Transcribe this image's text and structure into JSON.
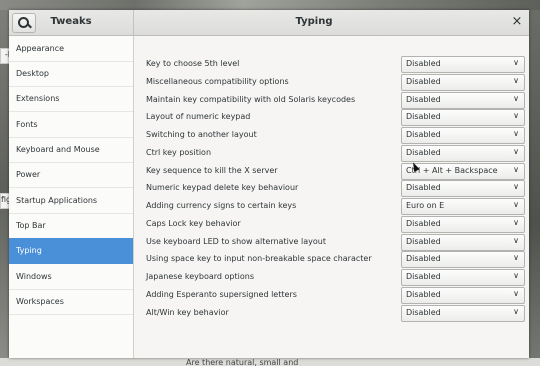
{
  "window": {
    "app_title": "Tweaks",
    "page_title": "Typing"
  },
  "header": {
    "close_glyph": "×"
  },
  "sidebar": {
    "items": [
      {
        "label": "Appearance"
      },
      {
        "label": "Desktop"
      },
      {
        "label": "Extensions"
      },
      {
        "label": "Fonts"
      },
      {
        "label": "Keyboard and Mouse"
      },
      {
        "label": "Power"
      },
      {
        "label": "Startup Applications"
      },
      {
        "label": "Top Bar"
      },
      {
        "label": "Typing",
        "active": true
      },
      {
        "label": "Windows"
      },
      {
        "label": "Workspaces"
      }
    ]
  },
  "settings": [
    {
      "label": "Key to choose 5th level",
      "value": "Disabled"
    },
    {
      "label": "Miscellaneous compatibility options",
      "value": "Disabled"
    },
    {
      "label": "Maintain key compatibility with old Solaris keycodes",
      "value": "Disabled"
    },
    {
      "label": "Layout of numeric keypad",
      "value": "Disabled"
    },
    {
      "label": "Switching to another layout",
      "value": "Disabled"
    },
    {
      "label": "Ctrl key position",
      "value": "Disabled"
    },
    {
      "label": "Key sequence to kill the X server",
      "value": "Ctrl + Alt + Backspace"
    },
    {
      "label": "Numeric keypad delete key behaviour",
      "value": "Disabled"
    },
    {
      "label": "Adding currency signs to certain keys",
      "value": "Euro on E"
    },
    {
      "label": "Caps Lock key behavior",
      "value": "Disabled"
    },
    {
      "label": "Use keyboard LED to show alternative layout",
      "value": "Disabled"
    },
    {
      "label": "Using space key to input non-breakable space character",
      "value": "Disabled"
    },
    {
      "label": "Japanese keyboard options",
      "value": "Disabled"
    },
    {
      "label": "Adding Esperanto supersigned letters",
      "value": "Disabled"
    },
    {
      "label": "Alt/Win key behavior",
      "value": "Disabled"
    }
  ],
  "dropdown_chevron": "∨",
  "background": {
    "bottom_text": "Are there natural, small and",
    "left_fragments": [
      "-l",
      "fig"
    ]
  },
  "colors": {
    "accent": "#4a90d9",
    "text": "#2e3436"
  },
  "icons": {
    "search": "search-icon",
    "close": "close-icon",
    "chevron": "chevron-down-icon"
  }
}
